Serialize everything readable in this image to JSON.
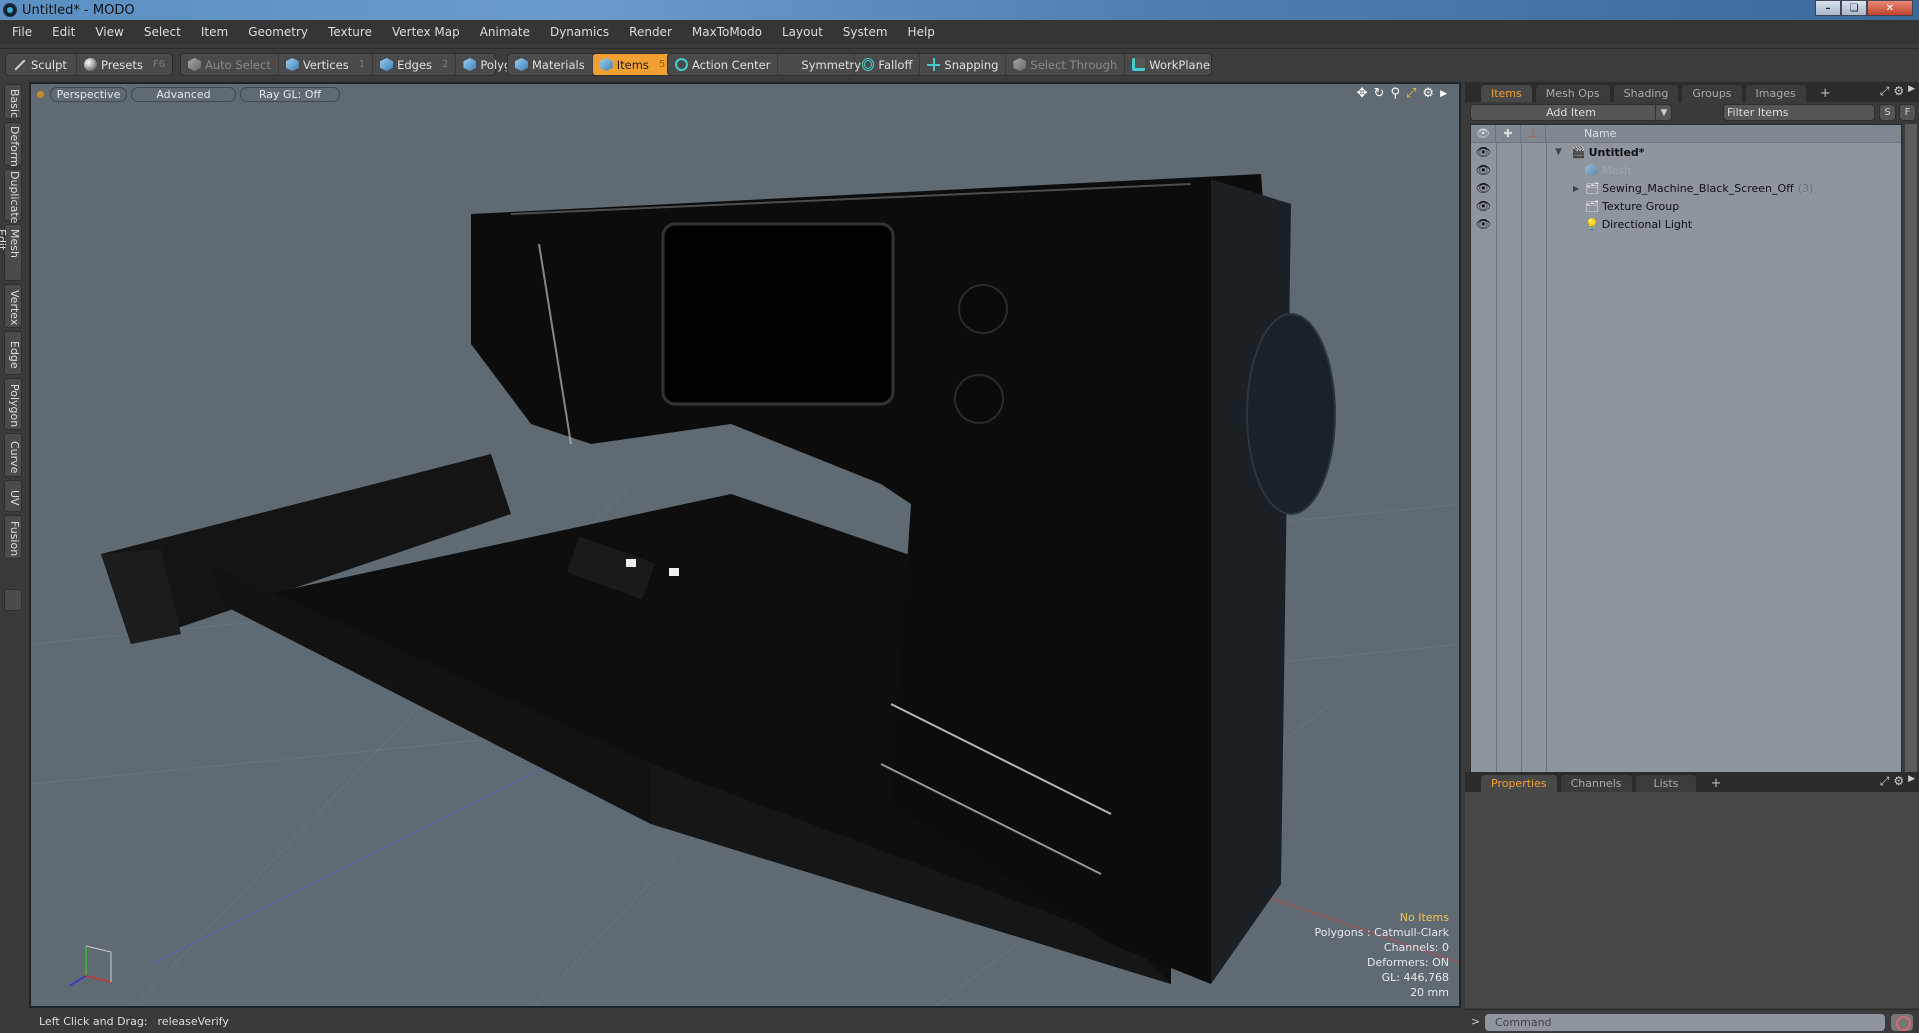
{
  "window": {
    "title": "Untitled* - MODO",
    "controls": [
      "minimize",
      "restore",
      "close"
    ]
  },
  "menu": [
    "File",
    "Edit",
    "View",
    "Select",
    "Item",
    "Geometry",
    "Texture",
    "Vertex Map",
    "Animate",
    "Dynamics",
    "Render",
    "MaxToModo",
    "Layout",
    "System",
    "Help"
  ],
  "toolbar": {
    "sculpt": "Sculpt",
    "presets": "Presets",
    "presets_key": "F6",
    "auto_select": "Auto Select",
    "vertices": "Vertices",
    "vertices_key": "1",
    "edges": "Edges",
    "edges_key": "2",
    "polygons": "Polygons",
    "materials": "Materials",
    "items": "Items",
    "items_key": "5",
    "action_center": "Action Center",
    "symmetry": "Symmetry",
    "falloff": "Falloff",
    "snapping": "Snapping",
    "select_through": "Select Through",
    "workplane": "WorkPlane",
    "active_mode": "Items",
    "accent_color": "#f0a030"
  },
  "left_tabs": [
    "Basic",
    "Deform",
    "Duplicate",
    "Mesh Edit",
    "Vertex",
    "Edge",
    "Polygon",
    "Curve",
    "UV",
    "Fusion"
  ],
  "viewport": {
    "view": "Perspective",
    "shading": "Advanced",
    "raygl": "Ray GL: Off",
    "info": {
      "selection": "No Items",
      "polygons": "Polygons : Catmull-Clark",
      "channels": "Channels: 0",
      "deformers": "Deformers: ON",
      "gl": "GL: 446,768",
      "grid": "20 mm"
    },
    "axes": {
      "x": "X",
      "y": "Y",
      "z": "Z"
    }
  },
  "status": {
    "hint_label": "Left Click and Drag:",
    "hint_value": "releaseVerify"
  },
  "items_panel": {
    "tabs": [
      "Items",
      "Mesh Ops",
      "Shading",
      "Groups",
      "Images"
    ],
    "active_tab": "Items",
    "add_item": "Add Item",
    "filter_placeholder": "Filter Items",
    "s_btn": "S",
    "f_btn": "F",
    "column_name": "Name",
    "tree": [
      {
        "label": "Untitled*",
        "icon": "scene-icon",
        "bold": true,
        "expanded": true,
        "level": 0
      },
      {
        "label": "Mesh",
        "icon": "mesh-icon",
        "dim": true,
        "level": 1
      },
      {
        "label": "Sewing_Machine_Black_Screen_Off",
        "icon": "group-icon",
        "count": "(3)",
        "collapsed": true,
        "level": 1
      },
      {
        "label": "Texture Group",
        "icon": "group-icon",
        "level": 1
      },
      {
        "label": "Directional Light",
        "icon": "light-icon",
        "level": 1
      }
    ]
  },
  "properties_panel": {
    "tabs": [
      "Properties",
      "Channels",
      "Lists"
    ],
    "active_tab": "Properties"
  },
  "command": {
    "placeholder": "Command",
    "prompt": ">"
  }
}
